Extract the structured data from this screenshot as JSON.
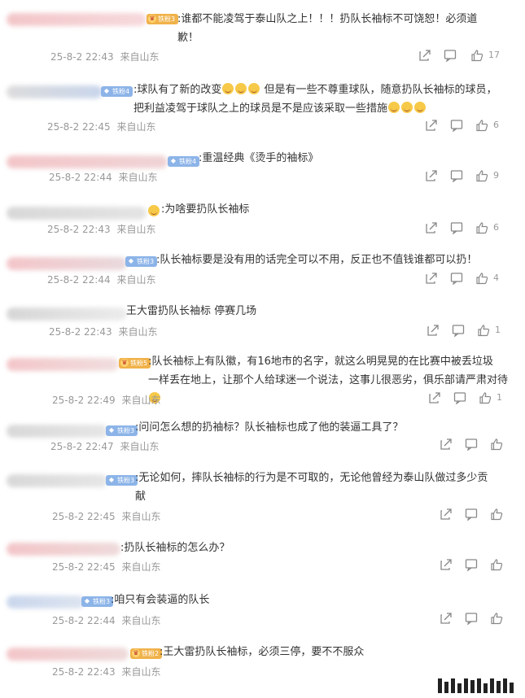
{
  "comments": [
    {
      "text": ":谁都不能凌驾于泰山队之上！！！扔队长袖标不可饶恕！必须道\n歉！",
      "date": "25-8-2 22:43",
      "location": "来自山东",
      "likes": "17",
      "badge": "铁粉3"
    },
    {
      "text": ":球队有了新的改变",
      "text_tail": " 但是有一些不尊重球队，随意扔队长袖标的球员，\n把利益凌驾于球队之上的球员是不是应该采取一些措施",
      "date": "25-8-2 22:45",
      "location": "来自山东",
      "likes": "6",
      "badge": "铁粉4"
    },
    {
      "text": ":重温经典《烫手的袖标》",
      "date": "25-8-2 22:44",
      "location": "来自山东",
      "likes": "9",
      "badge": "铁粉4"
    },
    {
      "text": ":为啥要扔队长袖标",
      "date": "25-8-2 22:43",
      "location": "来自山东",
      "likes": "6",
      "badge": ""
    },
    {
      "text": ":队长袖标要是没有用的话完全可以不用，反正也不值钱谁都可以扔！",
      "date": "25-8-2 22:44",
      "location": "来自山东",
      "likes": "4",
      "badge": "铁粉3"
    },
    {
      "text": "王大雷扔队长袖标 停赛几场",
      "date": "25-8-2 22:43",
      "location": "来自山东",
      "likes": "1",
      "badge": ""
    },
    {
      "text": ":队长袖标上有队徽，有16地市的名字，就这么明晃晃的在比赛中被丢垃圾\n一样丢在地上，让那个人给球迷一个说法，这事儿很恶劣，俱乐部请严肃对待",
      "date": "25-8-2 22:49",
      "location": "来自山东",
      "likes": "1",
      "badge": "铁粉5"
    },
    {
      "text": ":问问怎么想的扔袖标？队长袖标也成了他的装逼工具了？",
      "date": "25-8-2 22:47",
      "location": "来自山东",
      "likes": "",
      "badge": "铁粉3"
    },
    {
      "text": ":无论如何，摔队长袖标的行为是不可取的，无论他曾经为泰山队做过多少贡\n献",
      "date": "25-8-2 22:45",
      "location": "来自山东",
      "likes": "",
      "badge": "铁粉3"
    },
    {
      "text": ":扔队长袖标的怎么办？",
      "date": "25-8-2 22:45",
      "location": "来自山东",
      "likes": "",
      "badge": ""
    },
    {
      "text": ":咱只有会装逼的队长",
      "date": "25-8-2 22:44",
      "location": "来自山东",
      "likes": "",
      "badge": "铁粉3"
    },
    {
      "text": ":王大雷扔队长袖标，必须三停，要不不服众",
      "date": "25-8-2 22:43",
      "location": "来自山东",
      "likes": "",
      "badge": "铁粉2"
    }
  ],
  "colors": {
    "text": "#333333",
    "meta": "#999999",
    "icon": "#888888",
    "badge_blue": "#8cb4e8",
    "badge_gold": "#f0b24a",
    "blur_pink": "#f3c6c9",
    "blur_blue": "#c9d6ec"
  },
  "icons": {
    "share": "share-icon",
    "comment": "comment-icon",
    "like": "thumbs-up-icon",
    "emoji": "smiling-face-icon",
    "watermark": "barcode-logo"
  }
}
